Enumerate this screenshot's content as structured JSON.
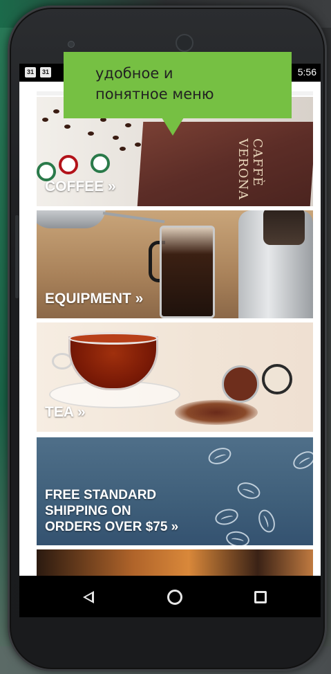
{
  "statusbar": {
    "icon1": "31",
    "icon2": "31",
    "time": "5:56"
  },
  "tooltip": {
    "text_line1": "удобное и",
    "text_line2": "понятное меню",
    "color": "#76c043"
  },
  "menu": {
    "coffee_label": "COFFEE »",
    "equipment_label": "EQUIPMENT »",
    "tea_label": "TEA »",
    "shipping_line1": "FREE STANDARD",
    "shipping_line2": "SHIPPING ON",
    "shipping_line3": "ORDERS OVER $75 »"
  },
  "coffee_bag_text": "CAFFÈ VERONA",
  "navbar": {
    "back_icon": "triangle-back",
    "home_icon": "circle-home",
    "recent_icon": "square-recents"
  }
}
